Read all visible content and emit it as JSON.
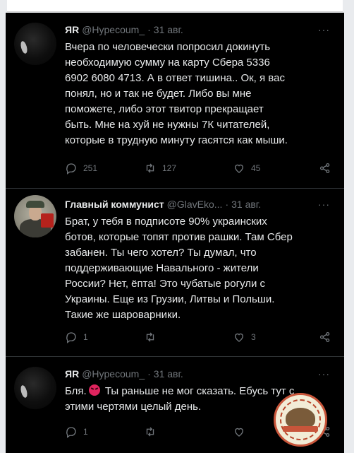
{
  "tweets": [
    {
      "name": "ЯR",
      "handle": "@Hypecoum_",
      "dot": "·",
      "date": "31 авг.",
      "more": "···",
      "text": "Вчера по человечески попросил докинуть\nнеобходимую сумму на карту Сбера 5336\n6902 6080 4713. А в ответ тишина.. Ок, я вас\nпонял, но и так не будет. Либо вы мне\nпоможете, либо этот твитор прекращает\nбыть. Мне на хуй не нужны 7К читателей,\nкоторые в трудную минуту гасятся как мыши.",
      "replies": "251",
      "retweets": "127",
      "likes": "45"
    },
    {
      "name": "Главный коммунист",
      "handle": "@GlavEko...",
      "dot": "·",
      "date": "31 авг.",
      "more": "···",
      "text": "Брат, у тебя в подписоте 90% украинских\nботов, которые топят против рашки. Там Сбер\nзабанен. Ты чего хотел? Ты думал, что\nподдерживающие Навального - жители\nРоссии? Нет, ёпта! Это чубатые рогули с\nУкраины. Еще из Грузии, Литвы и Польши.\nТакие же шароварники.",
      "replies": "1",
      "retweets": "",
      "likes": "3"
    },
    {
      "name": "ЯR",
      "handle": "@Hypecoum_",
      "dot": "·",
      "date": "31 авг.",
      "more": "···",
      "text_before_emoji": "Бля.",
      "text_after_emoji": " Ты раньше не мог сказать. Ебусь тут с\nэтими чертями целый день.",
      "replies": "1",
      "retweets": "",
      "likes": ""
    }
  ],
  "colors": {
    "background": "#000000",
    "text": "#e7e9ea",
    "muted": "#71767b",
    "divider": "#2f3336",
    "angry_emoji": "#e0245e"
  }
}
